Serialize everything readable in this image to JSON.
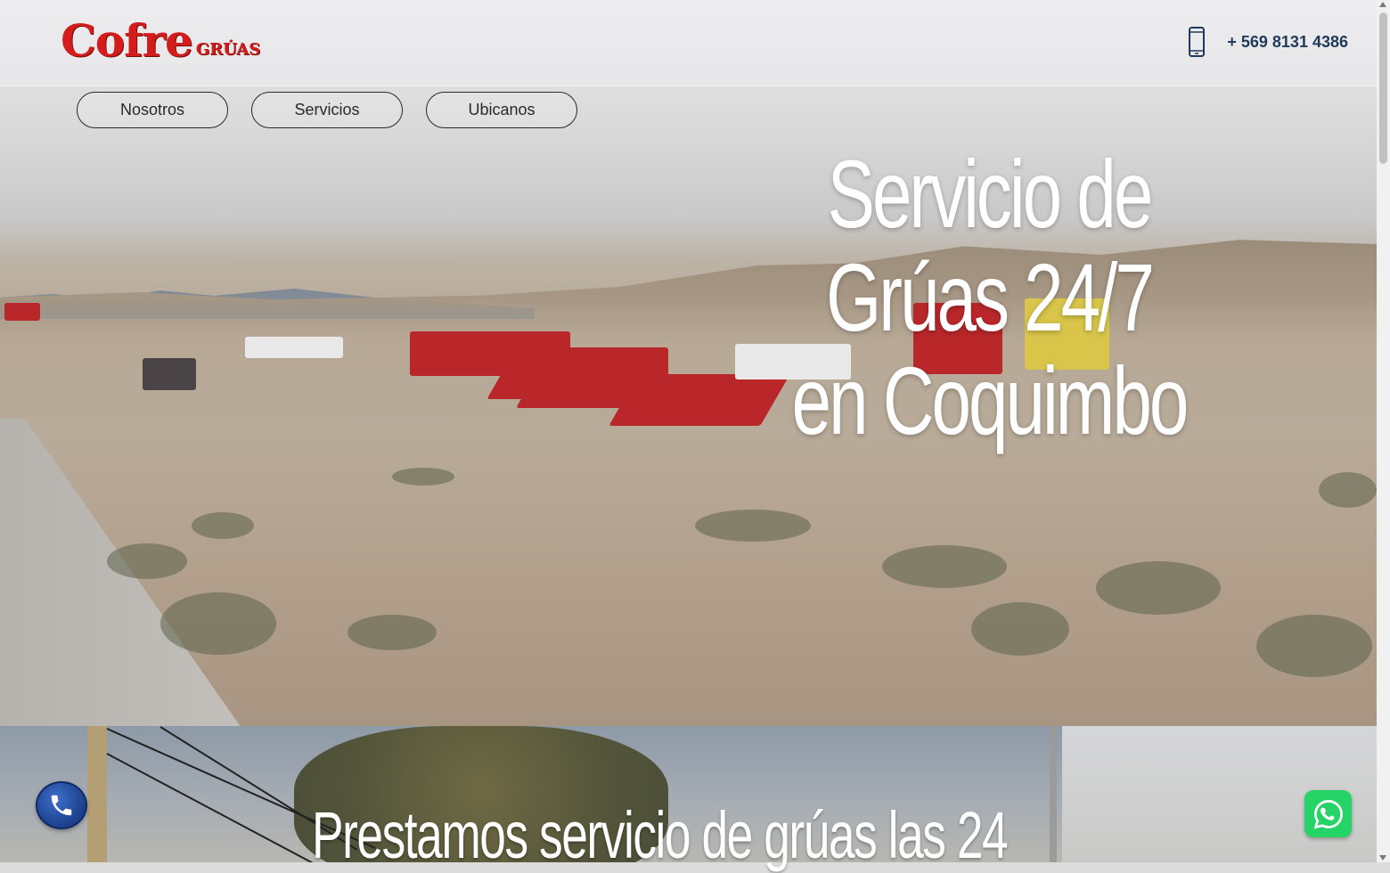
{
  "brand": {
    "name": "Cofre",
    "tagline": "GRÚAS"
  },
  "header": {
    "phone_icon": "mobile-phone-icon",
    "phone_number": "+ 569 8131 4386"
  },
  "nav": {
    "items": [
      {
        "label": "Nosotros"
      },
      {
        "label": "Servicios"
      },
      {
        "label": "Ubicanos"
      }
    ]
  },
  "hero": {
    "title_lines": [
      "Servicio de",
      "Grúas 24/7",
      "en Coquimbo"
    ]
  },
  "section2": {
    "title": "Prestamos servicio de grúas las 24"
  },
  "floating": {
    "call_icon": "phone-call-icon",
    "whatsapp_icon": "whatsapp-icon"
  },
  "colors": {
    "brand_red": "#d41c1c",
    "phone_text": "#1f3a5a",
    "whatsapp_green": "#25d366",
    "call_blue": "#1b3f8c"
  }
}
